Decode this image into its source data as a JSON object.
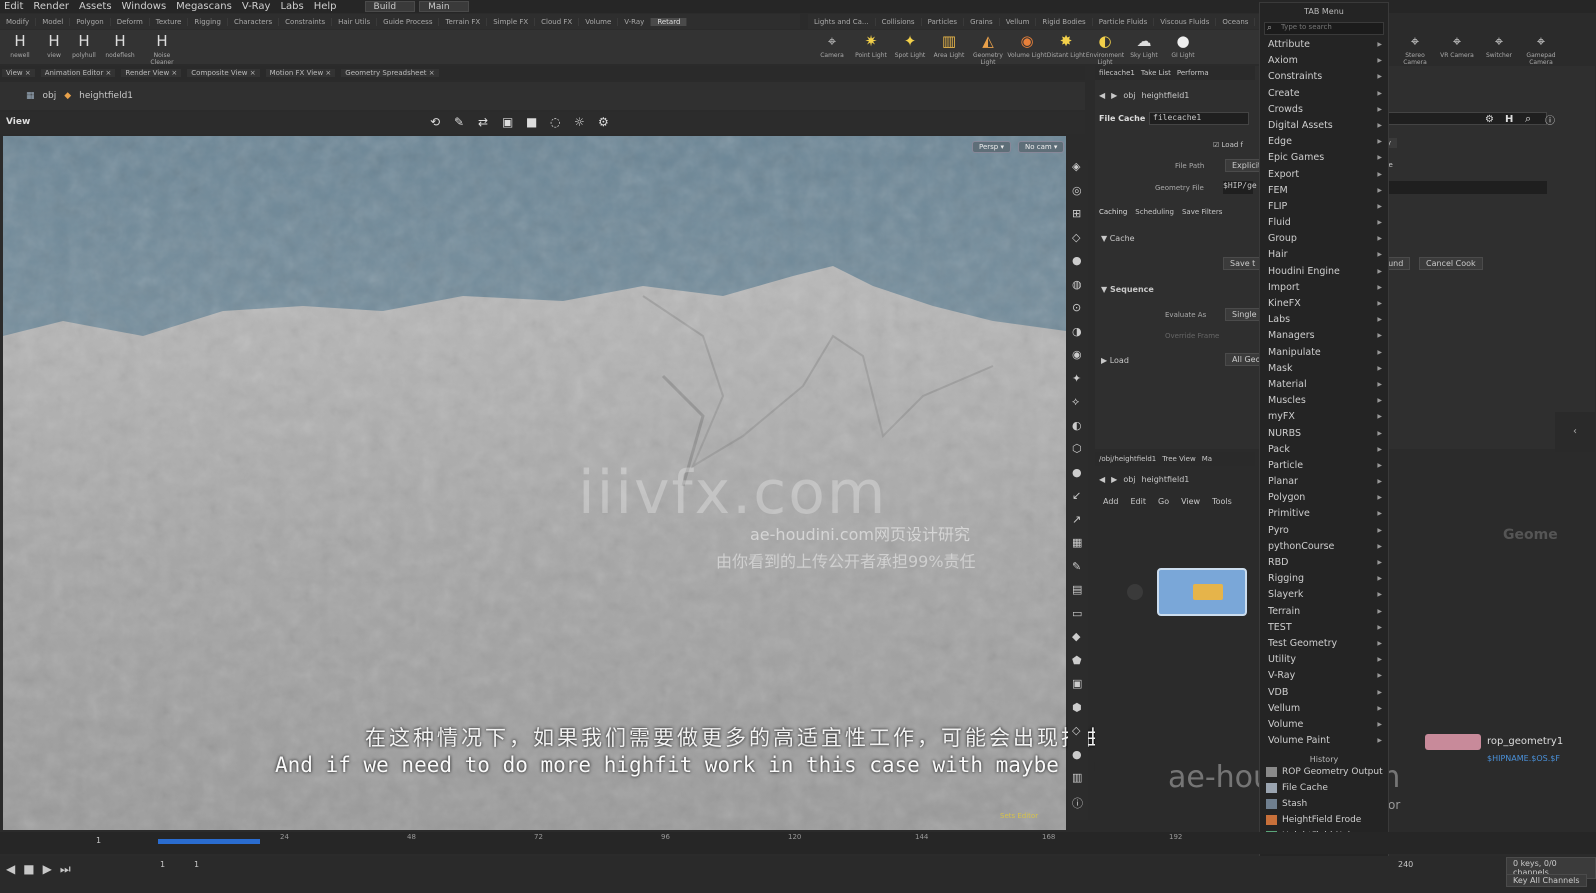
{
  "menubar": {
    "items": [
      "Edit",
      "Render",
      "Assets",
      "Windows",
      "Megascans",
      "V-Ray",
      "Labs",
      "Help"
    ],
    "desktop": "Build",
    "desktop2": "Main"
  },
  "shelf_tabs": [
    "Modify",
    "Model",
    "Polygon",
    "Deform",
    "Texture",
    "Rigging",
    "Characters",
    "Constraints",
    "Hair Utils",
    "Guide Process",
    "Terrain FX",
    "Simple FX",
    "Cloud FX",
    "Volume",
    "V-Ray",
    "Retard"
  ],
  "shelf_tabs_right": [
    "Lights and Ca...",
    "Collisions",
    "Particles",
    "Grains",
    "Vellum",
    "Rigid Bodies",
    "Particle Fluids",
    "Viscous Fluids",
    "Oceans",
    "Pyro FX"
  ],
  "shelf_tools": [
    "newell",
    "view",
    "polyhull",
    "nodeflesh",
    "Noise Cleaner"
  ],
  "shelf_tools_right": [
    "Camera",
    "Point Light",
    "Spot Light",
    "Area Light",
    "Geometry Light",
    "Volume Light",
    "Distant Light",
    "Environment Light",
    "Sky Light",
    "GI Light"
  ],
  "shelf_tools_far": [
    "Stereo Camera",
    "VR Camera",
    "Switcher",
    "Gamepad Camera"
  ],
  "pane_tabs": [
    "View",
    "Animation Editor",
    "Render View",
    "Composite View",
    "Motion FX View",
    "Geometry Spreadsheet"
  ],
  "path": {
    "context": "obj",
    "node": "heightfield1"
  },
  "viewport": {
    "label": "View",
    "persp": "Persp ▾",
    "nocam": "No cam ▾",
    "note": "Sets Editor"
  },
  "watermark": {
    "main": "iiivfx.com",
    "line1": "ae-houdini.com网页设计研究",
    "line2": "由你看到的上传公开者承担99%责任",
    "site": "ae-houdini.com"
  },
  "subtitle": {
    "cn": "在这种情况下，如果我们需要做更多的高适宜性工作，可能会出现扭曲",
    "en": "And if we need to do more highfit work in this case with maybe a distortion"
  },
  "params": {
    "tabs": [
      "filecache1",
      "Take List",
      "Performa"
    ],
    "path_context": "obj",
    "path_node": "heightfield1",
    "node_type": "File Cache",
    "node_name": "filecache1",
    "load_label": "Load f",
    "file_path_label": "File Path",
    "file_path_value": "Explicit",
    "geometry_file_label": "Geometry File",
    "geometry_file_value": "$HIP/ge",
    "subtabs": [
      "Caching",
      "Scheduling",
      "Save Filters"
    ],
    "cache_section": "Cache",
    "save_btn": "Save t",
    "background_btn": "ground",
    "cancel_btn": "Cancel Cook",
    "sequence_section": "Sequence",
    "evaluate_label": "Evaluate As",
    "evaluate_value": "Single",
    "override_label": "Override Frame",
    "load_section": "Load",
    "load_value": "All Geo",
    "right_tag1": "etry",
    "right_tag2": "Cache"
  },
  "network": {
    "tabs": [
      "/obj/heightfield1",
      "Tree View",
      "Ma"
    ],
    "menu": [
      "Add",
      "Edit",
      "Go",
      "View",
      "Tools"
    ],
    "path_context": "obj",
    "path_node": "heightfield1",
    "geometry_label": "Geome",
    "rop_label": "rop_geometry1",
    "rop_path": "$HIPNAME.$OS.$F",
    "rator": "rator"
  },
  "tab_menu": {
    "title": "TAB Menu",
    "search_placeholder": "Type to search",
    "items": [
      "Attribute",
      "Axiom",
      "Constraints",
      "Create",
      "Crowds",
      "Digital Assets",
      "Edge",
      "Epic Games",
      "Export",
      "FEM",
      "FLIP",
      "Fluid",
      "Group",
      "Hair",
      "Houdini Engine",
      "Import",
      "KineFX",
      "Labs",
      "Managers",
      "Manipulate",
      "Mask",
      "Material",
      "Muscles",
      "myFX",
      "NURBS",
      "Pack",
      "Particle",
      "Planar",
      "Polygon",
      "Primitive",
      "Pyro",
      "pythonCourse",
      "RBD",
      "Rigging",
      "Slayerk",
      "Terrain",
      "TEST",
      "Test Geometry",
      "Utility",
      "V-Ray",
      "VDB",
      "Vellum",
      "Volume",
      "Volume Paint"
    ],
    "history_title": "History",
    "history": [
      {
        "label": "ROP Geometry Output",
        "color": "#8a8a8a"
      },
      {
        "label": "File Cache",
        "color": "#9aa4b0"
      },
      {
        "label": "Stash",
        "color": "#6f7f8f"
      },
      {
        "label": "HeightField Erode",
        "color": "#c8703a"
      },
      {
        "label": "HeightField Noise",
        "color": "#5aa57a"
      }
    ]
  },
  "timeline": {
    "ticks": [
      "24",
      "48",
      "72",
      "96",
      "120",
      "144",
      "168",
      "192"
    ],
    "current_frame": "1",
    "start": "1",
    "start2": "1",
    "end": "240",
    "keys": "0 keys, 0/0 channels",
    "key_all": "Key All Channels"
  },
  "colors": {
    "accent": "#2a6ccf",
    "sky": "#6f8796"
  }
}
